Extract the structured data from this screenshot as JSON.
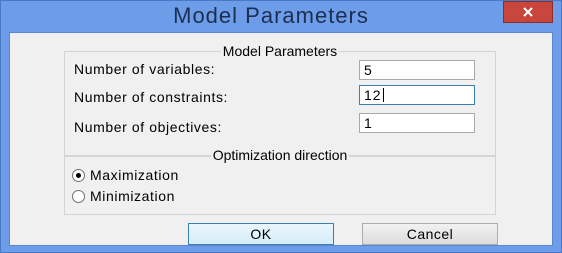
{
  "window": {
    "title": "Model Parameters",
    "close_glyph": "×"
  },
  "params_group": {
    "legend": "Model Parameters",
    "rows": [
      {
        "label": "Number of variables:",
        "value": "5"
      },
      {
        "label": "Number of constraints:",
        "value": "12"
      },
      {
        "label": "Number of objectives:",
        "value": "1"
      }
    ]
  },
  "direction_group": {
    "legend": "Optimization direction",
    "options": [
      {
        "label": "Maximization",
        "selected": true
      },
      {
        "label": "Minimization",
        "selected": false
      }
    ]
  },
  "buttons": {
    "ok_label": "OK",
    "cancel_label": "Cancel"
  },
  "colors": {
    "titlebar": "#6d9ce8",
    "close_button": "#c9463d",
    "dialog_bg": "#f0f0f0"
  },
  "icons": {
    "close": "close-icon",
    "radio_selected": "radio-selected-icon",
    "radio_unselected": "radio-unselected-icon"
  }
}
